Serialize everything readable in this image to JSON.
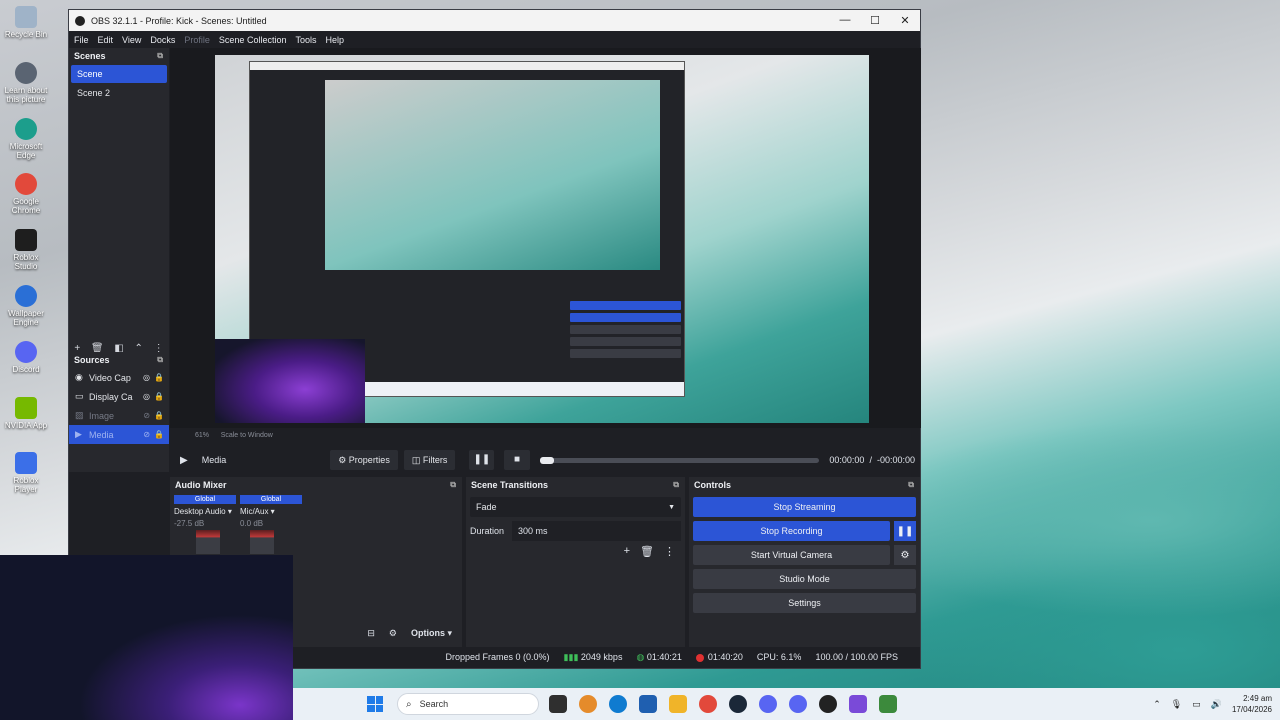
{
  "desktop": {
    "icons": [
      {
        "label": "Recycle Bin",
        "color": "#9fb3c8"
      },
      {
        "label": "Learn about this picture",
        "color": "#5a6472"
      },
      {
        "label": "Microsoft Edge",
        "color": "#1c9e8c"
      },
      {
        "label": "Google Chrome",
        "color": "#e2493b"
      },
      {
        "label": "Roblox Studio",
        "color": "#1e1e1e"
      },
      {
        "label": "Wallpaper Engine",
        "color": "#2a6fd6"
      },
      {
        "label": "Discord",
        "color": "#5865f2"
      },
      {
        "label": "NVIDIA App",
        "color": "#76b900"
      },
      {
        "label": "Roblox Player",
        "color": "#3b6fe8"
      }
    ]
  },
  "window": {
    "title": "OBS 32.1.1 - Profile: Kick - Scenes: Untitled",
    "min": "—",
    "max": "☐",
    "close": "✕"
  },
  "menu": [
    "File",
    "Edit",
    "View",
    "Docks",
    "Profile",
    "Scene Collection",
    "Tools",
    "Help"
  ],
  "scenes": {
    "title": "Scenes",
    "items": [
      "Scene",
      "Scene 2"
    ]
  },
  "sources": {
    "title": "Sources",
    "items": [
      {
        "label": "Video Cap",
        "icon": "camera-icon"
      },
      {
        "label": "Display Ca",
        "icon": "monitor-icon"
      },
      {
        "label": "Image",
        "icon": "image-icon"
      },
      {
        "label": "Media",
        "icon": "play-icon"
      }
    ]
  },
  "preview": {
    "zoom": "61%",
    "scale_mode": "Scale to Window"
  },
  "media": {
    "label": "Media",
    "properties": "Properties",
    "filters": "Filters",
    "time": "00:00:00",
    "separator": "/",
    "remaining": "-00:00:00"
  },
  "mixer": {
    "title": "Audio Mixer",
    "channels": [
      {
        "badge": "Global",
        "name": "Desktop Audio",
        "db": "-27.5 dB"
      },
      {
        "badge": "Global",
        "name": "Mic/Aux",
        "db": "0.0 dB"
      }
    ],
    "options": "Options"
  },
  "transitions": {
    "title": "Scene Transitions",
    "selected": "Fade",
    "duration_label": "Duration",
    "duration_value": "300 ms"
  },
  "controls": {
    "title": "Controls",
    "stop_streaming": "Stop Streaming",
    "stop_recording": "Stop Recording",
    "virtual_camera": "Start Virtual Camera",
    "studio_mode": "Studio Mode",
    "settings": "Settings"
  },
  "status": {
    "dropped": "Dropped Frames 0 (0.0%)",
    "bitrate": "2049 kbps",
    "stream_time": "01:40:21",
    "rec_time": "01:40:20",
    "cpu": "CPU: 6.1%",
    "fps": "100.00 / 100.00 FPS"
  },
  "taskbar": {
    "search_placeholder": "Search",
    "time": "2:49 am",
    "date": "17/04/2026",
    "apps": [
      "#2f2f2f",
      "#e58b2b",
      "#0f7bd0",
      "#1f5fb0",
      "#f0b429",
      "#e2493b",
      "#1b2838",
      "#5865f2",
      "#5865f2",
      "#222222",
      "#7a4ad8",
      "#3c8a3c"
    ]
  },
  "accent": "#2c55d6"
}
